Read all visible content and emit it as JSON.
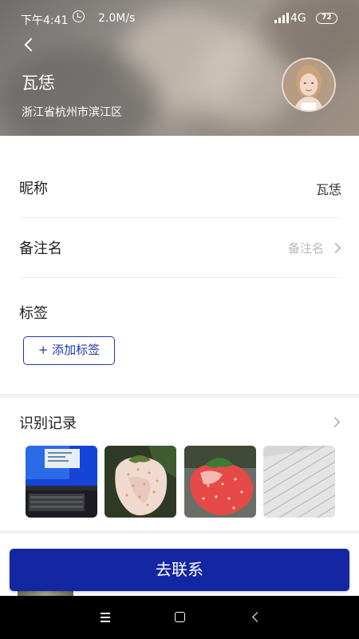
{
  "status_bar": {
    "time": "下午4:41",
    "speed": "2.0M/s",
    "network": "4G",
    "battery": "72",
    "icons": [
      "alarm-icon",
      "signal-icon",
      "battery-icon"
    ]
  },
  "header": {
    "name": "瓦恁",
    "location": "浙江省杭州市滨江区"
  },
  "profile": {
    "nickname_label": "昵称",
    "nickname_value": "瓦恁",
    "remark_label": "备注名",
    "remark_placeholder": "备注名",
    "tags_label": "标签",
    "add_tag_label": "+ 添加标签"
  },
  "records": {
    "title": "识别记录",
    "thumbnails": [
      "monitor-photo",
      "white-strawberry-photo",
      "red-strawberry-photo",
      "paper-photo"
    ]
  },
  "actions": {
    "contact_label": "去联系"
  },
  "colors": {
    "accent": "#1526a3",
    "tag_border": "#1e3aa8"
  }
}
